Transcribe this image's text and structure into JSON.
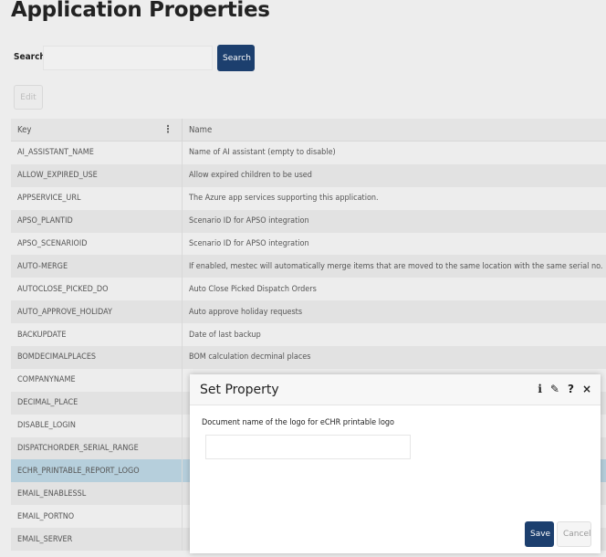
{
  "page": {
    "title": "Application Properties"
  },
  "search": {
    "label": "Search",
    "placeholder": "",
    "value": "",
    "button_label": "Search"
  },
  "toolbar": {
    "edit_label": "Edit"
  },
  "grid": {
    "columns": {
      "key": "Key",
      "name": "Name"
    },
    "menu_icon": "⋮",
    "rows": [
      {
        "key": "AI_ASSISTANT_NAME",
        "name": "Name of AI assistant (empty to disable)"
      },
      {
        "key": "ALLOW_EXPIRED_USE",
        "name": "Allow expired children to be used"
      },
      {
        "key": "APPSERVICE_URL",
        "name": "The Azure app services supporting this application."
      },
      {
        "key": "APSO_PLANTID",
        "name": "Scenario ID for APSO integration"
      },
      {
        "key": "APSO_SCENARIOID",
        "name": "Scenario ID for APSO integration"
      },
      {
        "key": "AUTO-MERGE",
        "name": "If enabled, mestec will automatically merge items that are moved to the same location with the same serial no."
      },
      {
        "key": "AUTOCLOSE_PICKED_DO",
        "name": "Auto Close Picked Dispatch Orders"
      },
      {
        "key": "AUTO_APPROVE_HOLIDAY",
        "name": "Auto approve holiday requests"
      },
      {
        "key": "BACKUPDATE",
        "name": "Date of last backup"
      },
      {
        "key": "BOMDECIMALPLACES",
        "name": "BOM calculation decminal places"
      },
      {
        "key": "COMPANYNAME",
        "name": ""
      },
      {
        "key": "DECIMAL_PLACE",
        "name": ""
      },
      {
        "key": "DISABLE_LOGIN",
        "name": ""
      },
      {
        "key": "DISPATCHORDER_SERIAL_RANGE",
        "name": ""
      },
      {
        "key": "ECHR_PRINTABLE_REPORT_LOGO",
        "name": ""
      },
      {
        "key": "EMAIL_ENABLESSL",
        "name": ""
      },
      {
        "key": "EMAIL_PORTNO",
        "name": ""
      },
      {
        "key": "EMAIL_SERVER",
        "name": ""
      }
    ],
    "selected_key": "ECHR_PRINTABLE_REPORT_LOGO"
  },
  "dialog": {
    "title": "Set Property",
    "icons": {
      "info": "i",
      "edit": "✎",
      "help": "?",
      "close": "×"
    },
    "field_label": "Document name of the logo for eCHR printable logo",
    "field_value": "",
    "save_label": "Save",
    "cancel_label": "Cancel"
  },
  "colors": {
    "primary": "#1c3f6e",
    "selected_row": "#b6cfdc"
  }
}
